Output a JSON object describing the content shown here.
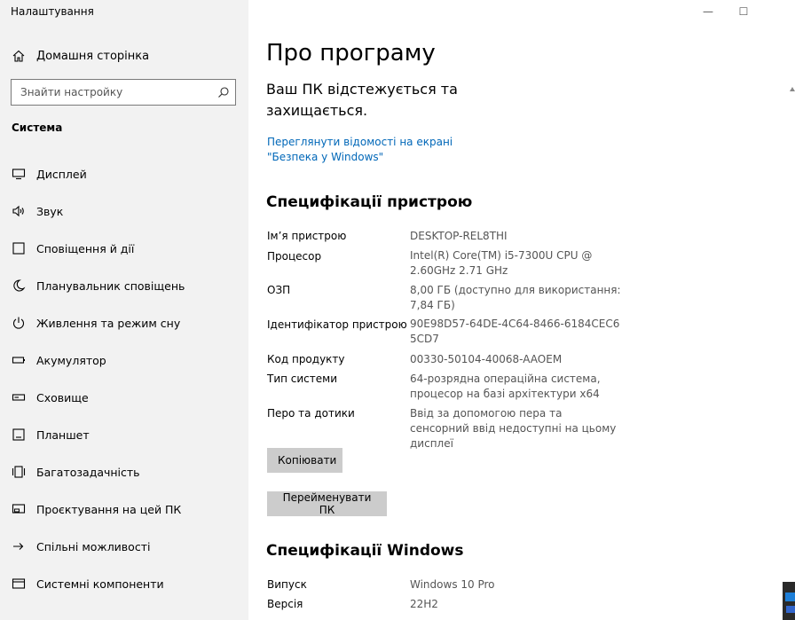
{
  "window": {
    "title": "Налаштування",
    "minimize_glyph": "—",
    "maximize_glyph": "☐"
  },
  "sidebar": {
    "home_label": "Домашня сторінка",
    "search_placeholder": "Знайти настройку",
    "section_title": "Система",
    "items": [
      {
        "label": "Дисплей",
        "icon": "display-icon"
      },
      {
        "label": "Звук",
        "icon": "sound-icon"
      },
      {
        "label": "Сповіщення й дії",
        "icon": "notifications-icon"
      },
      {
        "label": "Планувальник сповіщень",
        "icon": "moon-icon"
      },
      {
        "label": "Живлення та режим сну",
        "icon": "power-icon"
      },
      {
        "label": "Акумулятор",
        "icon": "battery-icon"
      },
      {
        "label": "Сховище",
        "icon": "storage-icon"
      },
      {
        "label": "Планшет",
        "icon": "tablet-icon"
      },
      {
        "label": "Багатозадачність",
        "icon": "multitasking-icon"
      },
      {
        "label": "Проєктування на цей ПК",
        "icon": "projecting-icon"
      },
      {
        "label": "Спільні можливості",
        "icon": "shared-icon"
      },
      {
        "label": "Системні компоненти",
        "icon": "components-icon"
      }
    ]
  },
  "main": {
    "title": "Про програму",
    "protection_status": "Ваш ПК відстежується та захищається.",
    "security_link": "Переглянути відомості на екрані \"Безпека у Windows\"",
    "device_specs": {
      "heading": "Специфікації пристрою",
      "rows": [
        {
          "label": "Ім’я пристрою",
          "value": "DESKTOP-REL8THI"
        },
        {
          "label": "Процесор",
          "value": "Intel(R) Core(TM) i5-7300U CPU @ 2.60GHz   2.71 GHz"
        },
        {
          "label": "ОЗП",
          "value": "8,00 ГБ (доступно для використання: 7,84 ГБ)"
        },
        {
          "label": "Ідентифікатор пристрою",
          "value": "90E98D57-64DE-4C64-8466-6184CEC65CD7"
        },
        {
          "label": "Код продукту",
          "value": "00330-50104-40068-AAOEM"
        },
        {
          "label": "Тип системи",
          "value": "64-розрядна операційна система, процесор на базі архітектури x64"
        },
        {
          "label": "Перо та дотики",
          "value": "Ввід за допомогою пера та сенсорний ввід недоступні на цьому дисплеї"
        }
      ],
      "copy_button": "Копіювати",
      "rename_button": "Перейменувати ПК"
    },
    "windows_specs": {
      "heading": "Специфікації Windows",
      "rows": [
        {
          "label": "Випуск",
          "value": "Windows 10 Pro"
        },
        {
          "label": "Версія",
          "value": "22H2"
        }
      ]
    }
  }
}
